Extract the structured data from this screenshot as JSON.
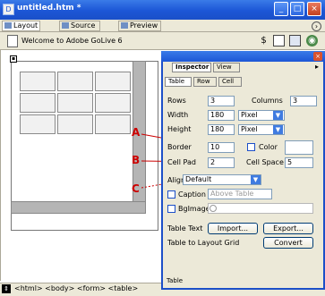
{
  "window": {
    "title": "untitled.htm *",
    "icon_letter": "D",
    "buttons": [
      "minimize",
      "maximize",
      "close"
    ]
  },
  "view_tabs": [
    {
      "label": "Layout",
      "selected": true
    },
    {
      "label": "Source",
      "selected": false
    },
    {
      "label": "Preview",
      "selected": false
    }
  ],
  "toolbar": {
    "doc_title": "Welcome to Adobe GoLive 6",
    "icons": [
      "settings-icon",
      "grid-icon",
      "table-icon",
      "globe-icon"
    ]
  },
  "tag_selector": {
    "path": "<html> <body> <form> <table>"
  },
  "inspector": {
    "tabs": [
      "Inspector",
      "View"
    ],
    "sub_tabs": [
      "Table",
      "Row",
      "Cell"
    ],
    "rows_label": "Rows",
    "rows_value": "3",
    "columns_label": "Columns",
    "columns_value": "3",
    "width_label": "Width",
    "width_value": "180",
    "width_unit": "Pixel",
    "height_label": "Height",
    "height_value": "180",
    "height_unit": "Pixel",
    "border_label": "Border",
    "border_value": "10",
    "color_label": "Color",
    "cellpad_label": "Cell Pad",
    "cellpad_value": "2",
    "cellspace_label": "Cell Space",
    "cellspace_value": "5",
    "align_label": "Align",
    "align_value": "Default",
    "caption_label": "Caption",
    "caption_value": "Above Table",
    "bgimage_label": "BgImage",
    "tabletext_label": "Table Text",
    "import_label": "Import...",
    "export_label": "Export...",
    "layoutgrid_label": "Table to Layout Grid",
    "convert_label": "Convert",
    "footer_label": "Table"
  },
  "annotations": [
    "A",
    "B",
    "C"
  ],
  "colors": {
    "annotation": "#cc0000",
    "titlebar": "#1c56d6",
    "panel": "#ece9d8"
  }
}
